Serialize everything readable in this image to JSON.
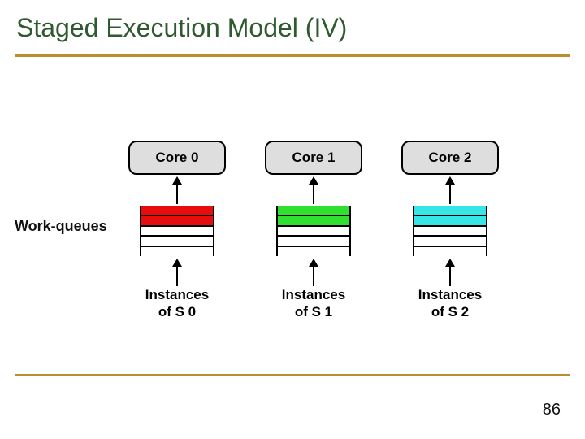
{
  "title": "Staged Execution Model (IV)",
  "page_number": "86",
  "wq_label": "Work-queues",
  "columns": [
    {
      "core_label": "Core 0",
      "instances_label_l1": "Instances",
      "instances_label_l2": "of S 0",
      "queue_colors": [
        "#e80d0d",
        "#e80d0d",
        "#ffffff",
        "#ffffff",
        "#ffffff"
      ]
    },
    {
      "core_label": "Core 1",
      "instances_label_l1": "Instances",
      "instances_label_l2": "of S 1",
      "queue_colors": [
        "#2fe02f",
        "#2fe02f",
        "#ffffff",
        "#ffffff",
        "#ffffff"
      ]
    },
    {
      "core_label": "Core 2",
      "instances_label_l1": "Instances",
      "instances_label_l2": "of S 2",
      "queue_colors": [
        "#36e6e6",
        "#36e6e6",
        "#ffffff",
        "#ffffff",
        "#ffffff"
      ]
    }
  ]
}
